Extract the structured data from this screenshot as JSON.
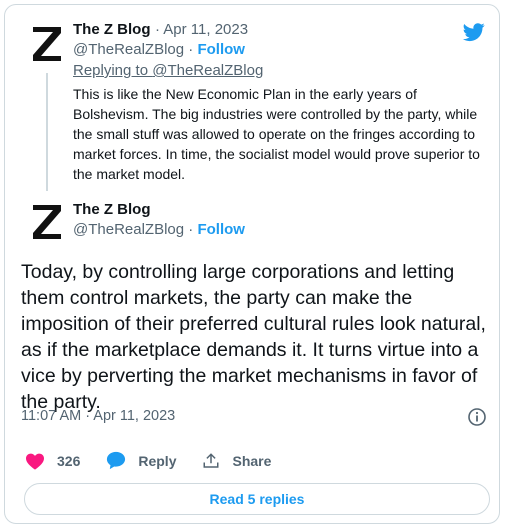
{
  "parent": {
    "author_name": "The Z Blog",
    "date": "· Apr 11, 2023",
    "handle": "@TheRealZBlog",
    "follow_sep": " · ",
    "follow_label": "Follow",
    "replying_prefix": "Replying to ",
    "replying_handle": "@TheRealZBlog",
    "text": "This is like the New Economic Plan in the early years of Bolshevism. The big industries were controlled by the party, while the small stuff was allowed to operate on the fringes according to market forces. In time, the socialist model would prove superior to the market model."
  },
  "main": {
    "author_name": "The Z Blog",
    "handle": "@TheRealZBlog",
    "follow_sep": " · ",
    "follow_label": "Follow",
    "text": "Today, by controlling large corporations and letting them control markets, the party can make the imposition of their preferred cultural rules look natural, as if the marketplace demands it. It turns virtue into a vice by perverting the market mechanisms in favor of the party.",
    "timestamp": "11:07 AM · Apr 11, 2023"
  },
  "actions": {
    "like_count": "326",
    "reply_label": "Reply",
    "share_label": "Share"
  },
  "read_replies_label": "Read 5 replies",
  "colors": {
    "accent": "#1d9bf0",
    "like": "#f91880",
    "muted": "#536471"
  },
  "icons": [
    "twitter-bird-icon",
    "info-icon",
    "heart-icon",
    "reply-bubble-icon",
    "share-icon"
  ]
}
